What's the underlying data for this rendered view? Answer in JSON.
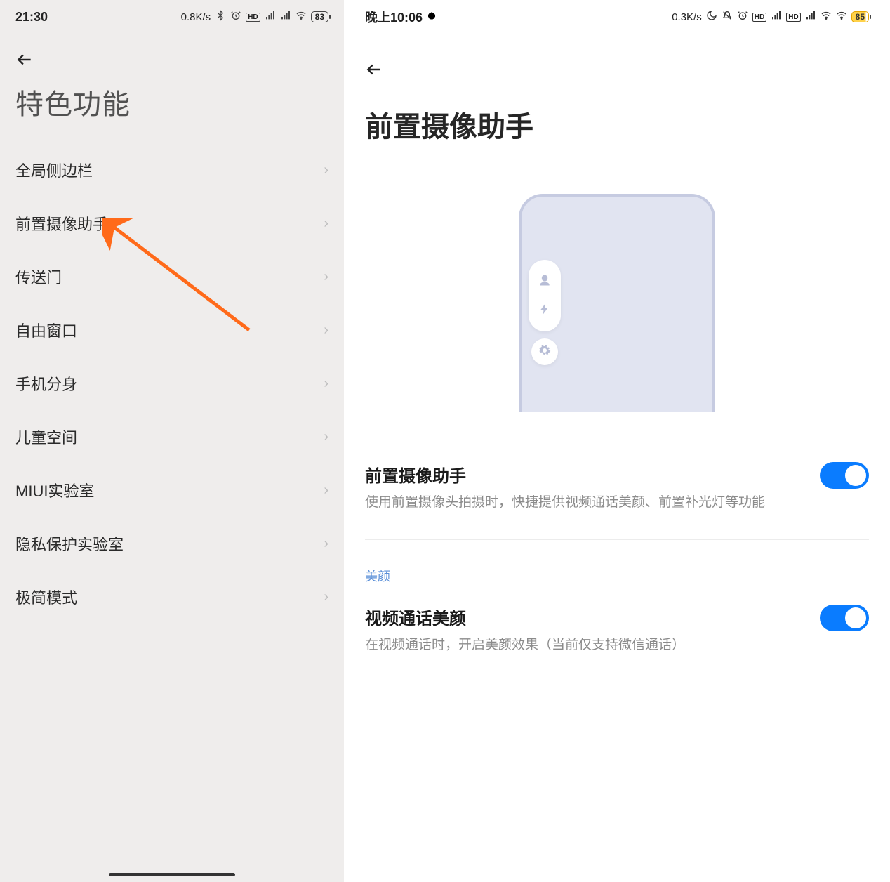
{
  "left": {
    "status": {
      "time": "21:30",
      "net": "0.8K/s",
      "battery": "83"
    },
    "title": "特色功能",
    "items": [
      {
        "label": "全局侧边栏"
      },
      {
        "label": "前置摄像助手"
      },
      {
        "label": "传送门"
      },
      {
        "label": "自由窗口"
      },
      {
        "label": "手机分身"
      },
      {
        "label": "儿童空间"
      },
      {
        "label": "MIUI实验室"
      },
      {
        "label": "隐私保护实验室"
      },
      {
        "label": "极简模式"
      }
    ]
  },
  "right": {
    "status": {
      "time": "晚上10:06",
      "net": "0.3K/s",
      "battery": "85"
    },
    "title": "前置摄像助手",
    "toggle1": {
      "title": "前置摄像助手",
      "desc": "使用前置摄像头拍摄时，快捷提供视频通话美颜、前置补光灯等功能",
      "on": true
    },
    "section_label": "美颜",
    "toggle2": {
      "title": "视频通话美颜",
      "desc": "在视频通话时，开启美颜效果（当前仅支持微信通话）",
      "on": true
    }
  }
}
